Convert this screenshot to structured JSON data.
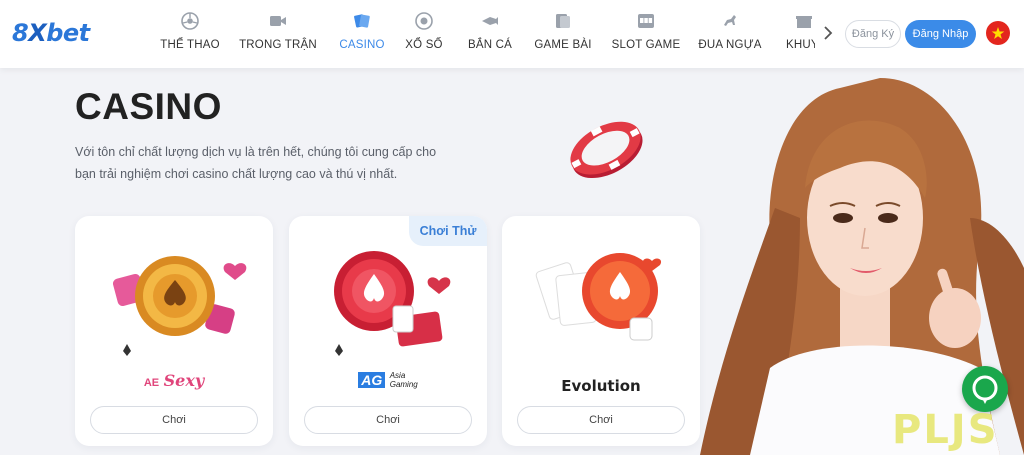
{
  "header": {
    "logo": {
      "part1": "8",
      "part2": "X",
      "part3": "bet"
    },
    "nav": [
      {
        "label": "THỂ THAO",
        "icon": "soccer-ball-icon"
      },
      {
        "label": "TRONG TRẬN",
        "icon": "video-camera-icon"
      },
      {
        "label": "CASINO",
        "icon": "playing-cards-icon",
        "active": true
      },
      {
        "label": "XỔ SỐ",
        "icon": "lottery-ball-icon"
      },
      {
        "label": "BẮN CÁ",
        "icon": "fish-gun-icon"
      },
      {
        "label": "GAME BÀI",
        "icon": "card-game-icon"
      },
      {
        "label": "SLOT GAME",
        "icon": "slot-machine-icon"
      },
      {
        "label": "ĐUA NGỰA",
        "icon": "horse-racing-icon"
      },
      {
        "label": "KHUYẾN MÃI",
        "icon": "gift-icon"
      }
    ],
    "register_label": "Đăng Ký",
    "login_label": "Đăng Nhập"
  },
  "hero": {
    "title": "CASINO",
    "description": "Với tôn chỉ chất lượng dịch vụ là trên hết, chúng tôi cung cấp cho bạn trải nghiệm chơi casino chất lượng cao và thú vị nhất."
  },
  "cards": [
    {
      "brand": "AE Sexy",
      "brand_main": "Sexy",
      "brand_small": "AE",
      "play_label": "Chơi"
    },
    {
      "brand": "AG Asia Gaming",
      "brand_main": "AG",
      "brand_line1": "Asia",
      "brand_line2": "Gaming",
      "play_label": "Chơi",
      "badge": "Chơi Thử"
    },
    {
      "brand": "Evolution",
      "brand_main": "Evolution",
      "play_label": "Chơi"
    }
  ],
  "watermark": "PLJS",
  "colors": {
    "accent": "#3b8be8",
    "chip_red": "#e23a45",
    "chat_green": "#1aa74c"
  }
}
